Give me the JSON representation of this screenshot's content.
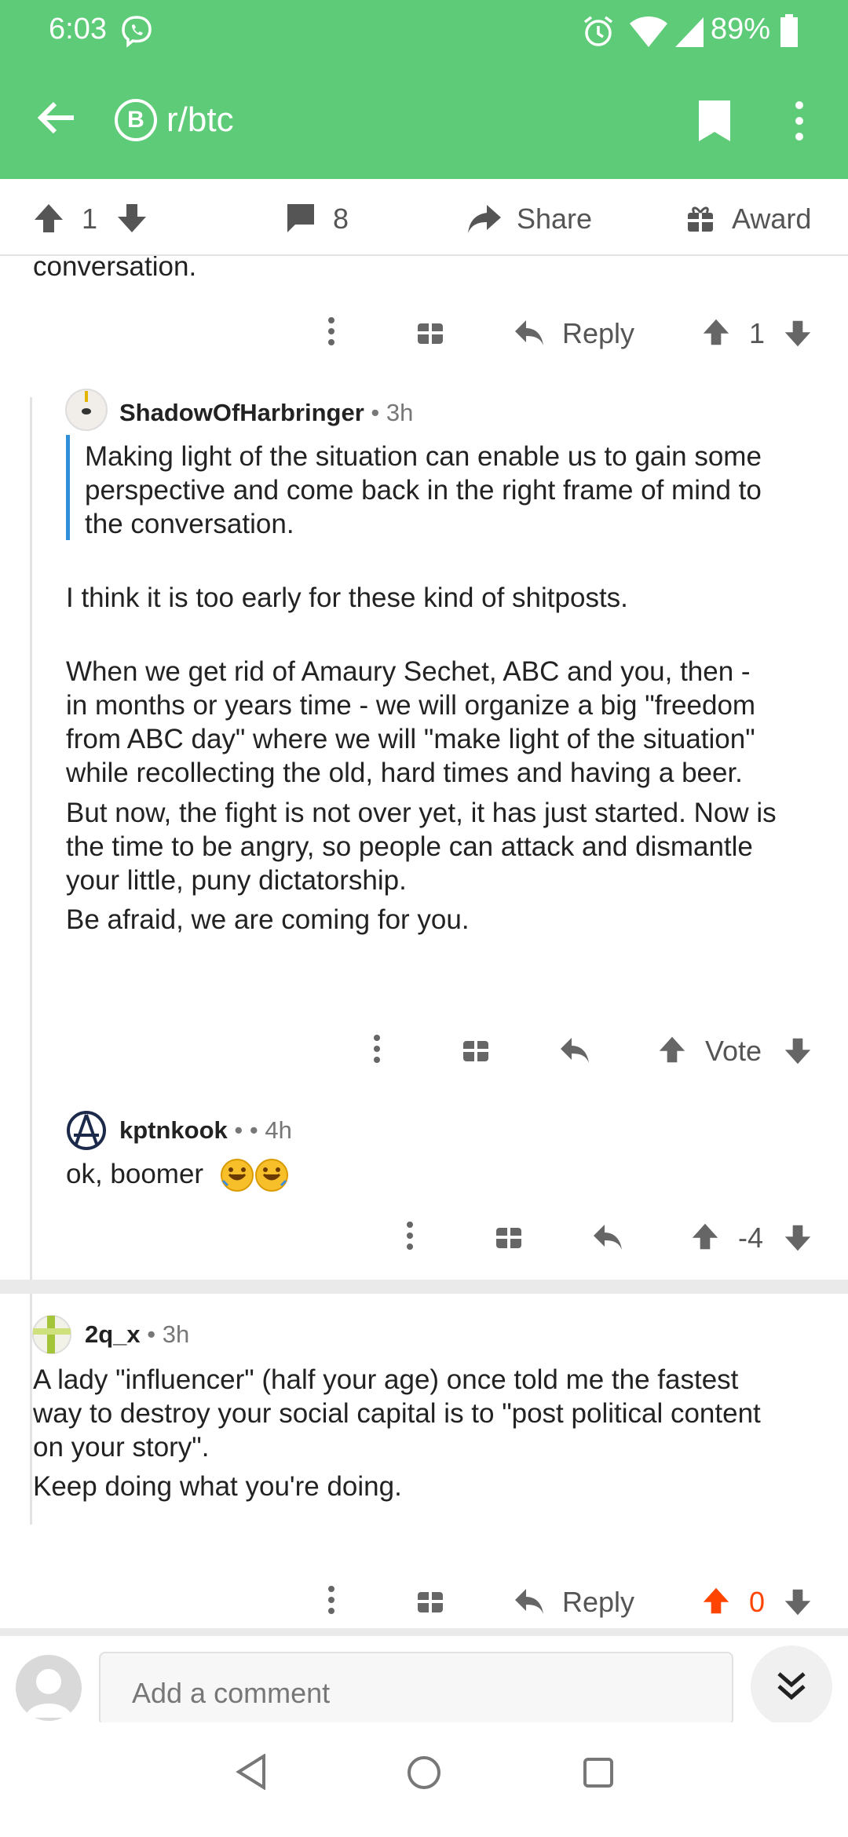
{
  "status_bar": {
    "time": "6:03",
    "battery": "89%"
  },
  "app_bar": {
    "subreddit": "r/btc",
    "sub_icon_letter": "B"
  },
  "post_actions": {
    "score": "1",
    "comments": "8",
    "share": "Share",
    "award": "Award"
  },
  "comments": [
    {
      "id": "c0",
      "partial_text": "conversation.",
      "actions": {
        "reply": "Reply",
        "score": "1"
      }
    },
    {
      "id": "c1",
      "author": "ShadowOfHarbringer",
      "time": "• 3h",
      "quote": [
        "Making light of the situation can enable us to gain some",
        "perspective and come back in the right frame of mind to",
        "the conversation."
      ],
      "paragraphs": [
        [
          "I think it is too early for these kind of shitposts."
        ],
        [
          "When we get rid of Amaury Sechet, ABC and you, then -",
          "in months or years time - we will organize a big \"freedom",
          "from ABC day\" where we will \"make light of the situation\"",
          "while recollecting the old, hard times and having a beer."
        ],
        [
          "But now, the fight is not over yet, it has just started. Now is",
          "the time to be angry, so people can attack and dismantle",
          "your little, puny dictatorship."
        ],
        [
          "Be afraid, we are coming for you."
        ]
      ],
      "actions": {
        "score": "Vote"
      }
    },
    {
      "id": "c2",
      "author": "kptnkook",
      "time": "• • 4h",
      "text": "ok, boomer",
      "actions": {
        "score": "-4"
      }
    },
    {
      "id": "c3",
      "author": "2q_x",
      "time": "• 3h",
      "paragraphs": [
        [
          "A lady \"influencer\" (half your age) once told me the fastest",
          "way to destroy your social capital is to \"post political content",
          "on your story\"."
        ],
        [
          "Keep doing what you're doing."
        ]
      ],
      "actions": {
        "reply": "Reply",
        "score": "0"
      }
    }
  ],
  "comment_bar": {
    "placeholder": "Add a comment"
  },
  "colors": {
    "brand_green": "#5ecb78",
    "upvote_orange": "#ff4500",
    "quote_blue": "#2f8fd8"
  }
}
